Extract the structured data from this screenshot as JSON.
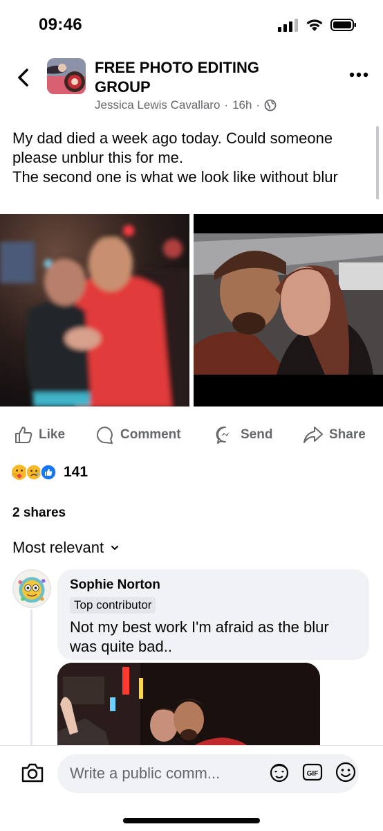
{
  "status_bar": {
    "time": "09:46"
  },
  "post": {
    "group_name": "FREE PHOTO EDITING GROUP",
    "author": "Jessica Lewis Cavallaro",
    "time_ago": "16h",
    "separator": "·",
    "text": "My dad died a week ago today. Could someone please unblur this for me.\nThe second one is what we look like without blur"
  },
  "actions": {
    "like_label": "Like",
    "comment_label": "Comment",
    "send_label": "Send",
    "share_label": "Share"
  },
  "reactions": {
    "count": "141"
  },
  "shares": {
    "label": "2 shares"
  },
  "sort": {
    "label": "Most relevant"
  },
  "comment": {
    "author": "Sophie Norton",
    "badge": "Top contributor",
    "text": "Not my best work I'm afraid as the blur was quite bad.."
  },
  "composer": {
    "placeholder": "Write a public comm...",
    "gif_label": "GIF"
  },
  "colors": {
    "secondary_text": "#65676b",
    "bubble_bg": "#f0f2f5",
    "like_blue": "#1877f2"
  }
}
